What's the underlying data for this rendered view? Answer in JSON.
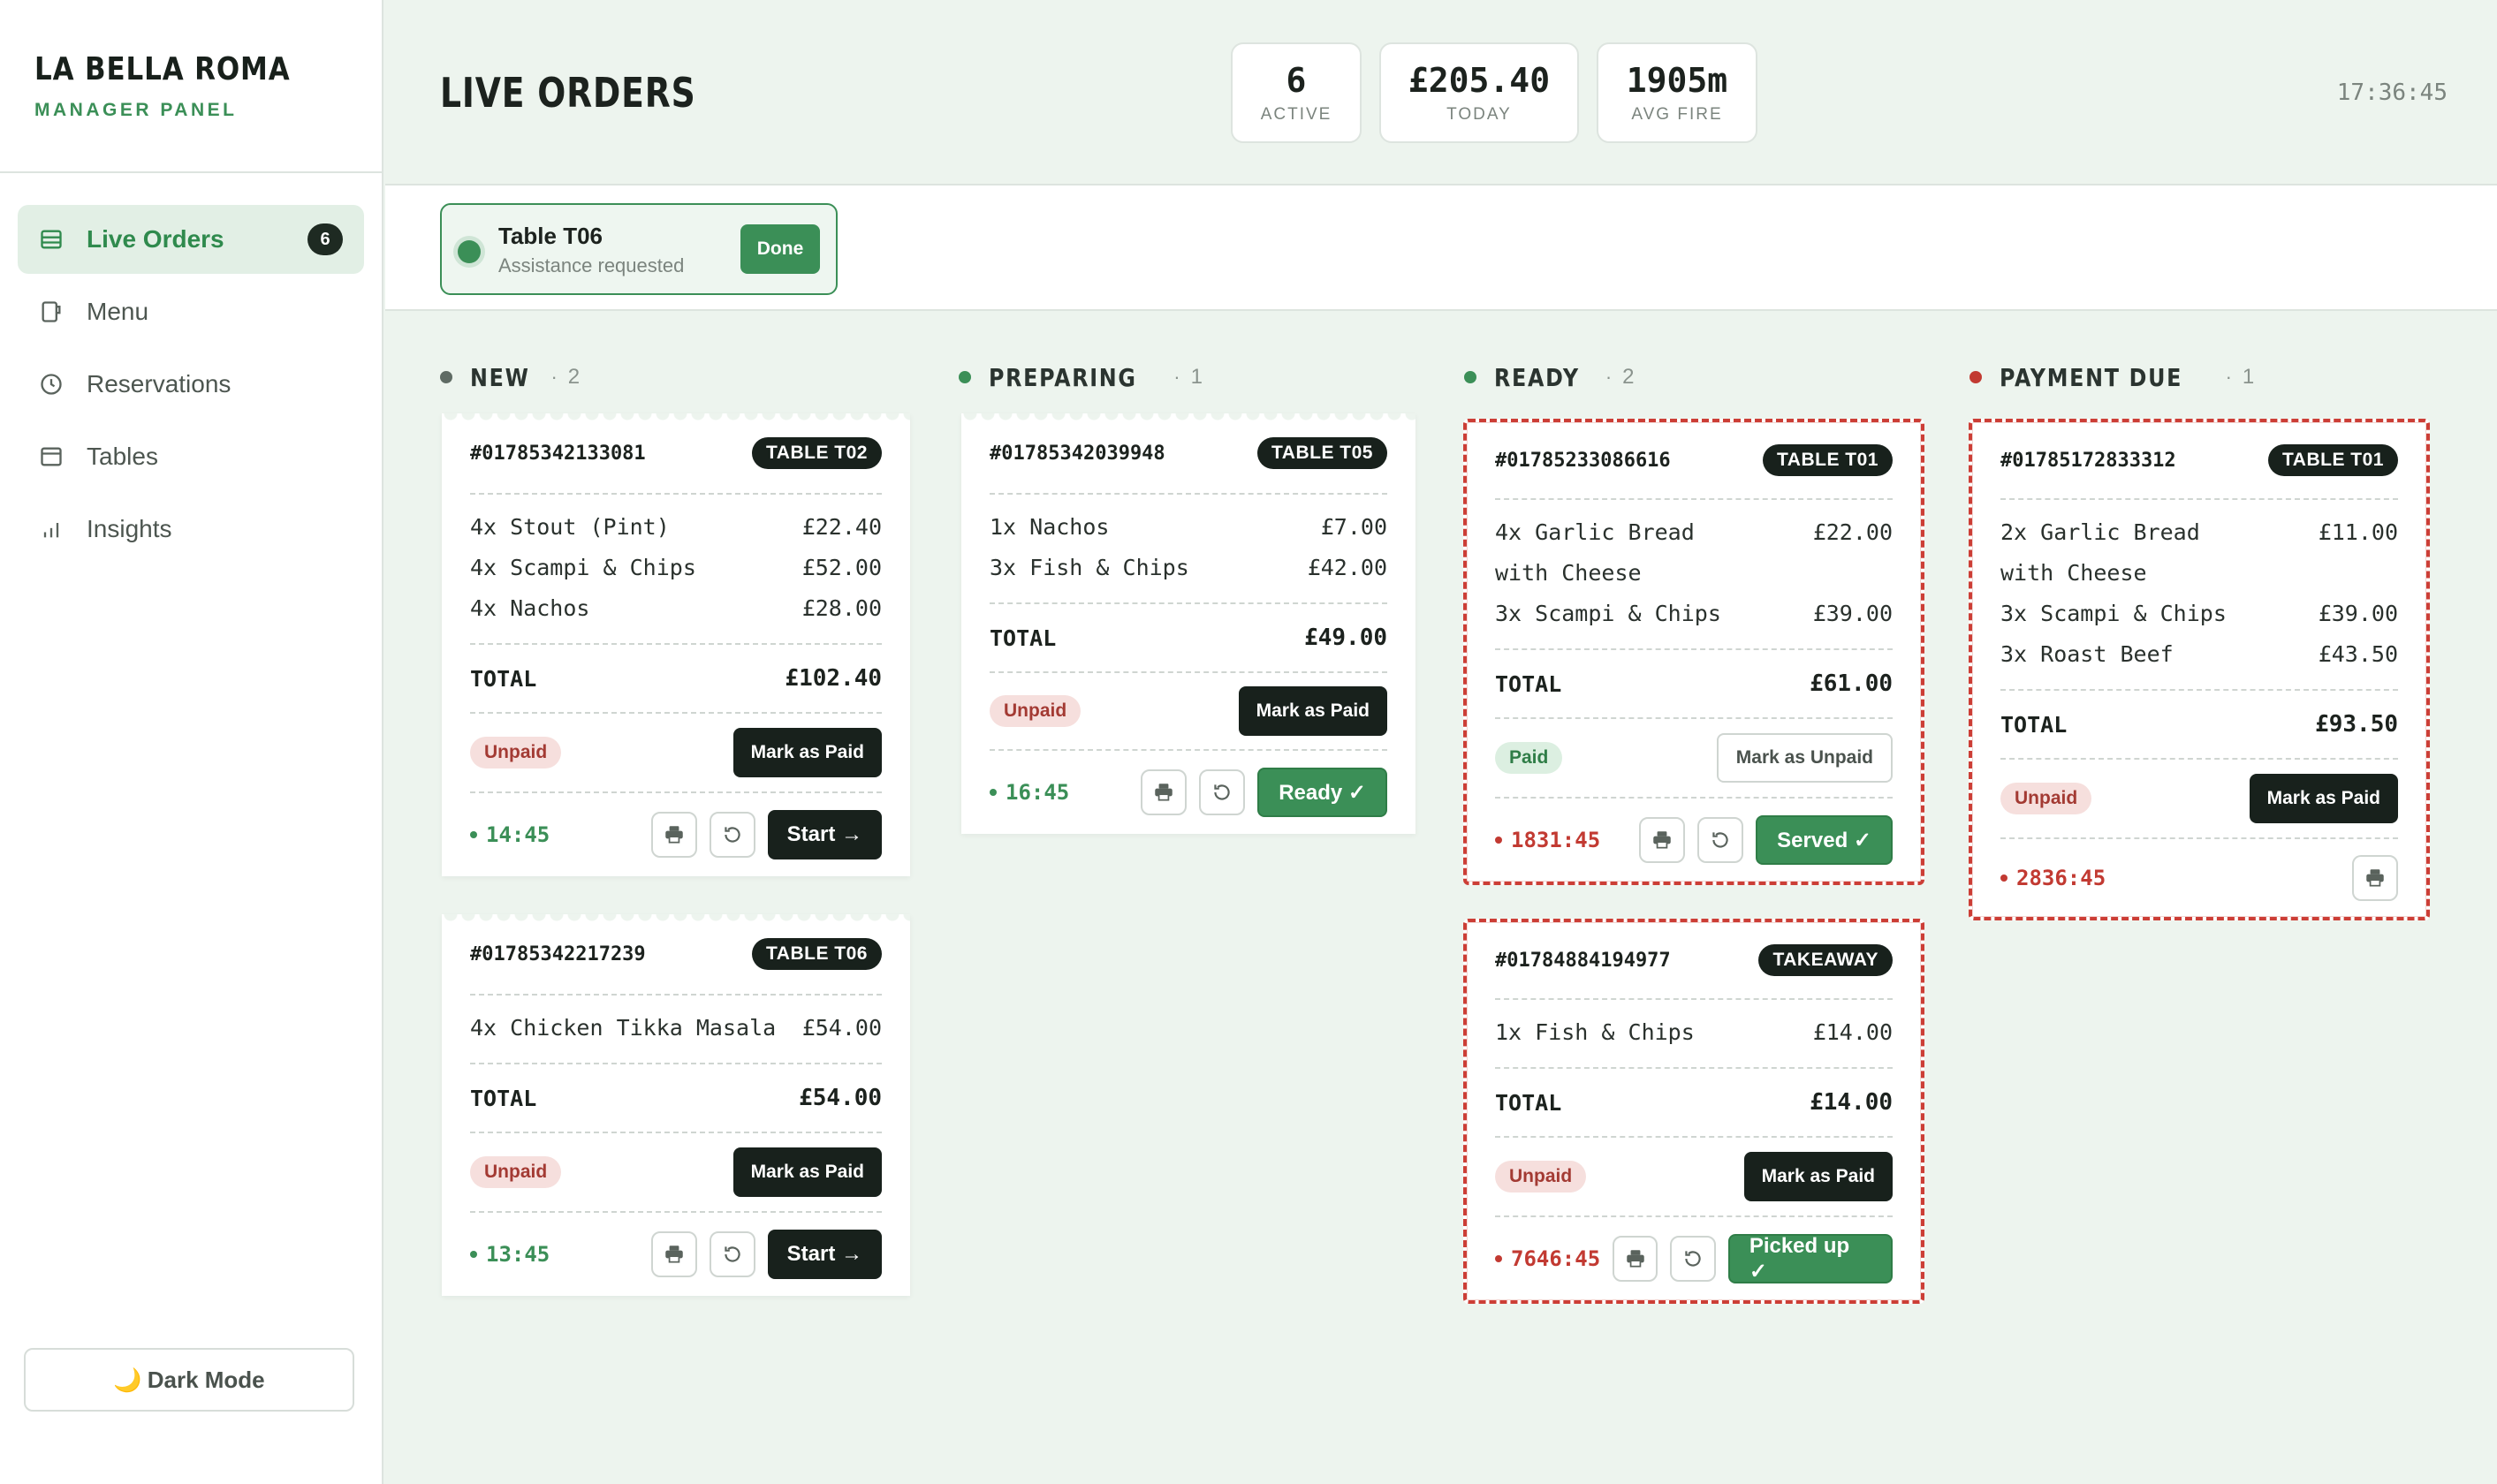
{
  "sidebar": {
    "brand_title": "LA BELLA ROMA",
    "brand_sub": "MANAGER PANEL",
    "nav": [
      {
        "label": "Live Orders",
        "icon": "orders-icon",
        "badge": "6",
        "active": true
      },
      {
        "label": "Menu",
        "icon": "menu-icon"
      },
      {
        "label": "Reservations",
        "icon": "clock-icon"
      },
      {
        "label": "Tables",
        "icon": "table-icon"
      },
      {
        "label": "Insights",
        "icon": "chart-icon"
      }
    ],
    "dark_mode_label": "Dark Mode",
    "dark_mode_icon": "🌙"
  },
  "header": {
    "title": "LIVE ORDERS",
    "stats": [
      {
        "value": "6",
        "label": "ACTIVE"
      },
      {
        "value": "£205.40",
        "label": "TODAY"
      },
      {
        "value": "1905m",
        "label": "AVG FIRE"
      }
    ],
    "clock": "17:36:45"
  },
  "alert": {
    "title": "Table T06",
    "subtitle": "Assistance requested",
    "done_label": "Done"
  },
  "columns": [
    {
      "title": "NEW",
      "count": "2",
      "color": "#5f6b64"
    },
    {
      "title": "PREPARING",
      "count": "1",
      "color": "#3b8f57"
    },
    {
      "title": "READY",
      "count": "2",
      "color": "#3b8f57"
    },
    {
      "title": "PAYMENT DUE",
      "count": "1",
      "color": "#c23a32"
    }
  ],
  "tickets": [
    {
      "id": "#01785342133081",
      "table": "TABLE T02",
      "items": [
        {
          "name": "4x Stout (Pint)",
          "price": "£22.40"
        },
        {
          "name": "4x Scampi & Chips",
          "price": "£52.00"
        },
        {
          "name": "4x Nachos",
          "price": "£28.00"
        }
      ],
      "total_label": "TOTAL",
      "total": "£102.40",
      "pay_status": "Unpaid",
      "pay_action": "Mark as Paid",
      "time": "14:45",
      "action": "Start →"
    },
    {
      "id": "#01785342217239",
      "table": "TABLE T06",
      "items": [
        {
          "name": "4x Chicken Tikka Masala",
          "price": "£54.00"
        }
      ],
      "total_label": "TOTAL",
      "total": "£54.00",
      "pay_status": "Unpaid",
      "pay_action": "Mark as Paid",
      "time": "13:45",
      "action": "Start →"
    },
    {
      "id": "#01785342039948",
      "table": "TABLE T05",
      "items": [
        {
          "name": "1x Nachos",
          "price": "£7.00"
        },
        {
          "name": "3x Fish & Chips",
          "price": "£42.00"
        }
      ],
      "total_label": "TOTAL",
      "total": "£49.00",
      "pay_status": "Unpaid",
      "pay_action": "Mark as Paid",
      "time": "16:45",
      "action": "Ready ✓"
    },
    {
      "id": "#01785233086616",
      "table": "TABLE T01",
      "items": [
        {
          "name": "4x Garlic Bread with Cheese",
          "price": "£22.00"
        },
        {
          "name": "3x Scampi & Chips",
          "price": "£39.00"
        }
      ],
      "total_label": "TOTAL",
      "total": "£61.00",
      "pay_status": "Paid",
      "pay_action": "Mark as Unpaid",
      "time": "1831:45",
      "action": "Served ✓"
    },
    {
      "id": "#01784884194977",
      "table": "TAKEAWAY",
      "items": [
        {
          "name": "1x Fish & Chips",
          "price": "£14.00"
        }
      ],
      "total_label": "TOTAL",
      "total": "£14.00",
      "pay_status": "Unpaid",
      "pay_action": "Mark as Paid",
      "time": "7646:45",
      "action": "Picked up ✓"
    },
    {
      "id": "#01785172833312",
      "table": "TABLE T01",
      "items": [
        {
          "name": "2x Garlic Bread with Cheese",
          "price": "£11.00"
        },
        {
          "name": "3x Scampi & Chips",
          "price": "£39.00"
        },
        {
          "name": "3x Roast Beef",
          "price": "£43.50"
        }
      ],
      "total_label": "TOTAL",
      "total": "£93.50",
      "pay_status": "Unpaid",
      "pay_action": "Mark as Paid",
      "time": "2836:45"
    }
  ],
  "colors": {
    "accent": "#3b8f57",
    "alert": "#c23a32",
    "dark": "#18211c",
    "background": "#edf4ee"
  }
}
